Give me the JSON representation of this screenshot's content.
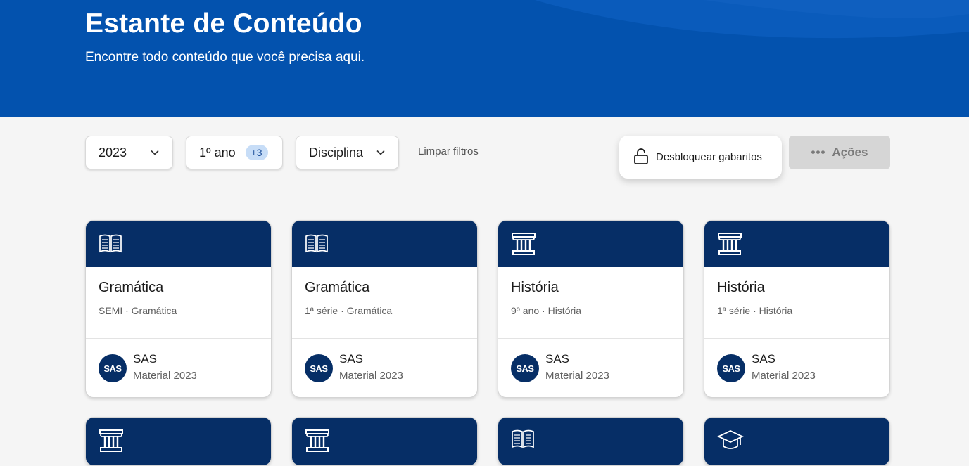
{
  "header": {
    "title": "Estante de Conteúdo",
    "subtitle": "Encontre todo conteúdo que você precisa aqui."
  },
  "filters": {
    "year": {
      "label": "2023",
      "icon": "chevron-down-icon"
    },
    "grade": {
      "label": "1º ano",
      "badge": "+3"
    },
    "subject": {
      "label": "Disciplina",
      "icon": "chevron-down-icon"
    },
    "clear_label": "Limpar filtros"
  },
  "toolbar": {
    "unlock_label": "Desbloquear gabaritos",
    "unlock_icon": "unlock-icon",
    "actions_label": "Ações",
    "actions_icon": "more-dots-icon",
    "actions_dots": "•••"
  },
  "cards": [
    {
      "icon": "open-book-icon",
      "title": "Gramática",
      "meta": "SEMI · Gramática",
      "publisher": "SAS",
      "publisher_logo": "SAS",
      "material": "Material 2023"
    },
    {
      "icon": "open-book-icon",
      "title": "Gramática",
      "meta": "1ª série · Gramática",
      "publisher": "SAS",
      "publisher_logo": "SAS",
      "material": "Material 2023"
    },
    {
      "icon": "column-icon",
      "title": "História",
      "meta": "9º ano · História",
      "publisher": "SAS",
      "publisher_logo": "SAS",
      "material": "Material 2023"
    },
    {
      "icon": "column-icon",
      "title": "História",
      "meta": "1ª série · História",
      "publisher": "SAS",
      "publisher_logo": "SAS",
      "material": "Material 2023"
    }
  ],
  "cards_row2": [
    {
      "icon": "column-icon"
    },
    {
      "icon": "column-icon"
    },
    {
      "icon": "open-book-icon"
    },
    {
      "icon": "graduation-cap-icon"
    }
  ],
  "colors": {
    "header_blue": "#0352ae",
    "card_head_navy": "#062e66",
    "badge_bg": "#c7ddf7"
  }
}
